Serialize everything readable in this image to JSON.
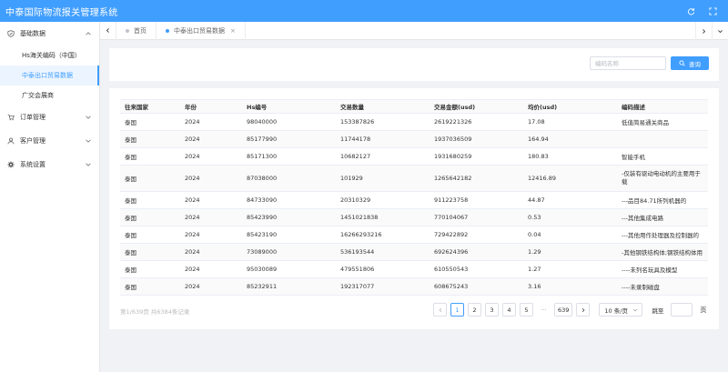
{
  "app": {
    "title": "中泰国际物流报关管理系统"
  },
  "sidebar": {
    "groups": [
      {
        "label": "基础数据",
        "items": [
          "Hs海关编码（中国）",
          "中泰出口贸易数据",
          "广交会展商"
        ]
      },
      {
        "label": "订单管理"
      },
      {
        "label": "客户管理"
      },
      {
        "label": "系统设置"
      }
    ]
  },
  "tabs": [
    {
      "label": "首页",
      "closable": false
    },
    {
      "label": "中泰出口贸易数据",
      "closable": true
    }
  ],
  "search": {
    "placeholder": "编码名称",
    "button_label": "查询"
  },
  "table": {
    "headers": [
      "往来国家",
      "年份",
      "Hs编号",
      "交易数量",
      "交易金额(usd)",
      "均价(usd)",
      "编码描述"
    ],
    "rows": [
      [
        "泰国",
        "2024",
        "98040000",
        "153387826",
        "2619221326",
        "17.08",
        "低值简易通关商品"
      ],
      [
        "泰国",
        "2024",
        "85177990",
        "11744178",
        "1937036509",
        "164.94",
        ""
      ],
      [
        "泰国",
        "2024",
        "85171300",
        "10682127",
        "1931680259",
        "180.83",
        "智能手机"
      ],
      [
        "泰国",
        "2024",
        "87038000",
        "101929",
        "1265642182",
        "12416.89",
        "-仅装有驱动电动机的主要用于载"
      ],
      [
        "泰国",
        "2024",
        "84733090",
        "20310329",
        "911223758",
        "44.87",
        "---品目84.71所列机器的"
      ],
      [
        "泰国",
        "2024",
        "85423990",
        "1451021838",
        "770104067",
        "0.53",
        "---其他集成电路"
      ],
      [
        "泰国",
        "2024",
        "85423190",
        "16266293216",
        "729422892",
        "0.04",
        "---其他用作处理器及控制器的"
      ],
      [
        "泰国",
        "2024",
        "73089000",
        "536193544",
        "692624396",
        "1.29",
        "-其他钢铁结构体;钢铁结构体用"
      ],
      [
        "泰国",
        "2024",
        "95030089",
        "479551806",
        "610550543",
        "1.27",
        "----未列名玩具及模型"
      ],
      [
        "泰国",
        "2024",
        "85232911",
        "192317077",
        "608675243",
        "3.16",
        "----未录制磁盘"
      ]
    ]
  },
  "pagination": {
    "summary": "第1/639页  共6384条记录",
    "pages": [
      "1",
      "2",
      "3",
      "4",
      "5"
    ],
    "ellipsis": "···",
    "last_page": "639",
    "current_page": 1,
    "page_size": "10 条/页",
    "jump_label": "跳至",
    "jump_suffix": "页"
  },
  "colors": {
    "primary": "#409eff",
    "background": "#f0f2f5"
  }
}
